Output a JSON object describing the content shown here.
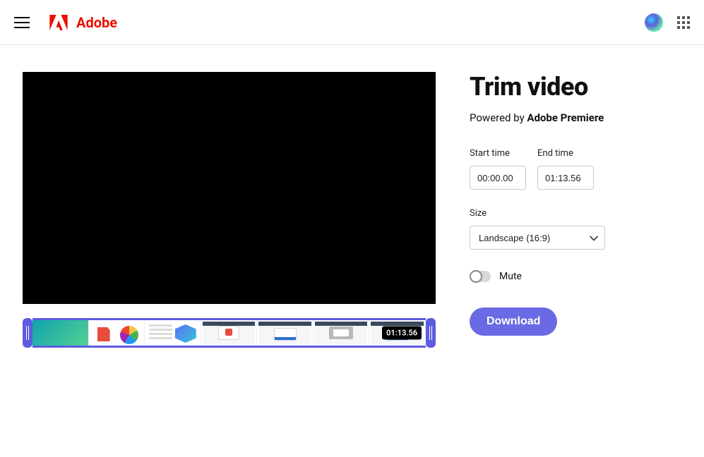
{
  "header": {
    "brand": "Adobe"
  },
  "page": {
    "title": "Trim video",
    "powered_prefix": "Powered by ",
    "powered_product": "Adobe Premiere"
  },
  "form": {
    "start_label": "Start time",
    "start_value": "00:00.00",
    "end_label": "End time",
    "end_value": "01:13.56",
    "size_label": "Size",
    "size_value": "Landscape (16:9)",
    "mute_label": "Mute",
    "mute_on": false,
    "download_label": "Download"
  },
  "timeline": {
    "badge": "01:13.56"
  }
}
